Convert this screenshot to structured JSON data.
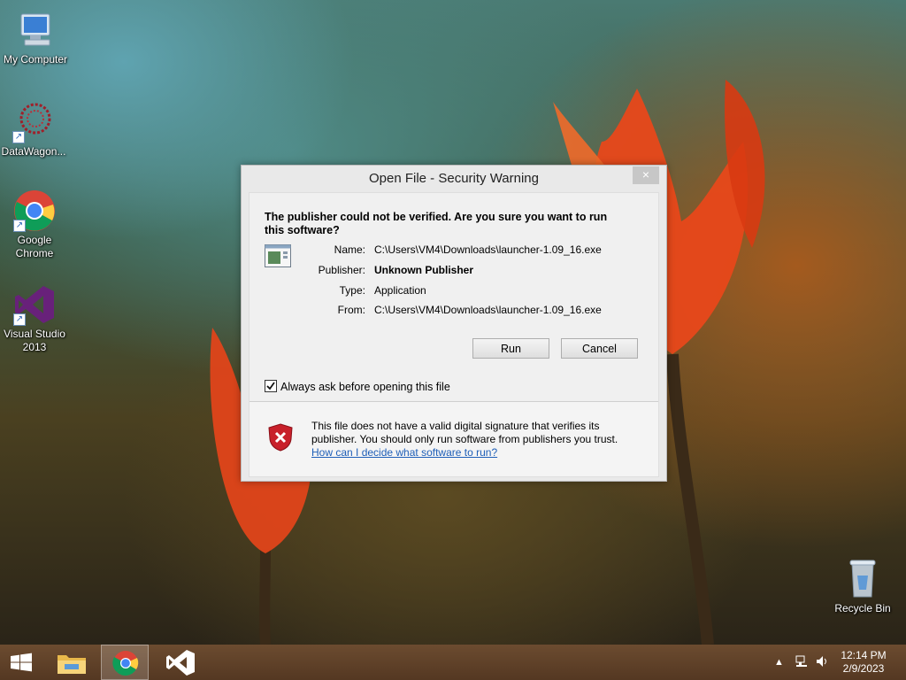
{
  "desktop": {
    "icons": [
      {
        "label": "My Computer"
      },
      {
        "label": "DataWagon..."
      },
      {
        "label": "Google Chrome"
      },
      {
        "label": "Visual Studio 2013"
      },
      {
        "label": "Recycle Bin"
      }
    ]
  },
  "dialog": {
    "title": "Open File - Security Warning",
    "close_glyph": "×",
    "question": "The publisher could not be verified.  Are you sure you want to run this software?",
    "fields": [
      {
        "key": "Name:",
        "value": "C:\\Users\\VM4\\Downloads\\launcher-1.09_16.exe"
      },
      {
        "key": "Publisher:",
        "value": "Unknown Publisher"
      },
      {
        "key": "Type:",
        "value": "Application"
      },
      {
        "key": "From:",
        "value": "C:\\Users\\VM4\\Downloads\\launcher-1.09_16.exe"
      }
    ],
    "run_label": "Run",
    "cancel_label": "Cancel",
    "checkbox_label": "Always ask before opening this file",
    "checkbox_checked": true,
    "warning_text": "This file does not have a valid digital signature that verifies its publisher.  You should only run software from publishers you trust.",
    "help_link": "How can I decide what software to run?"
  },
  "taskbar": {
    "time": "12:14 PM",
    "date": "2/9/2023"
  },
  "colors": {
    "taskbar": "#5a3a1c",
    "link": "#1f5fb8",
    "shield_red": "#c8202a"
  }
}
